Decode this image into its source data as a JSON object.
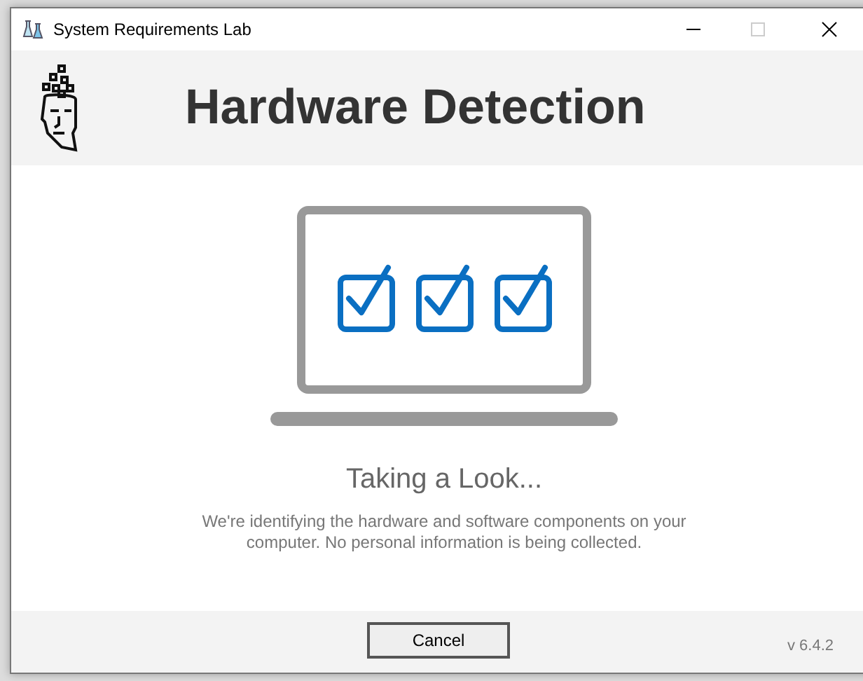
{
  "window": {
    "title": "System Requirements Lab"
  },
  "header": {
    "title": "Hardware Detection"
  },
  "status": {
    "heading": "Taking a Look...",
    "message": "We're identifying the hardware and software components on your computer. No personal information is being collected."
  },
  "footer": {
    "button": "Cancel",
    "version": "v 6.4.2"
  }
}
